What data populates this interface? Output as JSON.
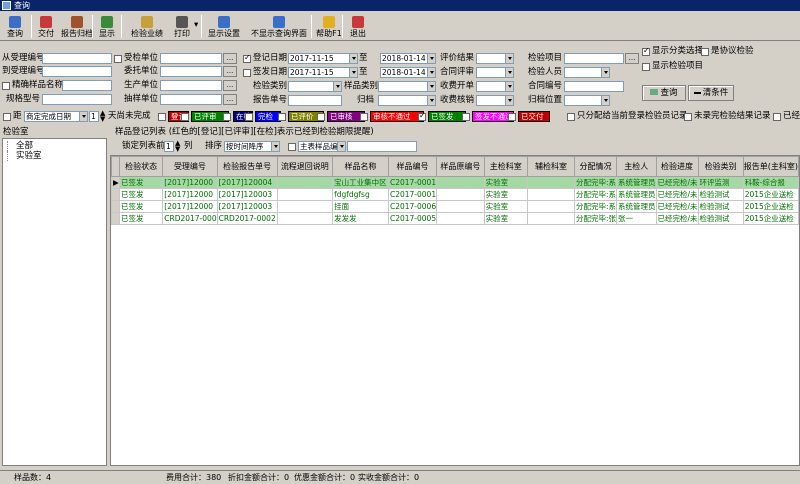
{
  "window": {
    "title": "查询"
  },
  "toolbar": [
    {
      "label": "查询",
      "icon": "search-icon"
    },
    {
      "label": "交付",
      "icon": "deliver-icon"
    },
    {
      "label": "报告归档",
      "icon": "archive-icon"
    },
    {
      "label": "显示",
      "icon": "display-icon"
    },
    {
      "label": "检验业绩",
      "icon": "performance-icon"
    },
    {
      "label": "打印",
      "icon": "print-icon"
    },
    {
      "label": "显示设置",
      "icon": "display-settings-icon"
    },
    {
      "label": "不显示查询界面",
      "icon": "hide-query-icon"
    },
    {
      "label": "帮助F1",
      "icon": "help-icon"
    },
    {
      "label": "退出",
      "icon": "exit-icon"
    }
  ],
  "form": {
    "acceptance_no_from": "从受理编号",
    "acceptance_no_to": "到受理编号",
    "exact_sample_name": "精确样品名称",
    "spec_model": "规格型号",
    "entrust_unit": "受检单位",
    "consign_unit": "委托单位",
    "produce_unit": "生产单位",
    "sampling_unit": "抽样单位",
    "reg_date": "登记日期",
    "issue_date": "签发日期",
    "test_category": "检验类别",
    "report_no": "报告单号",
    "date_from1": "2017-11-15",
    "date_to1": "2018-01-14",
    "date_from2": "2017-11-15",
    "date_to2": "2018-01-14",
    "to": "至",
    "eval_result": "评价结果",
    "contract_review": "合同评审",
    "fee_bill": "收费开单",
    "fee_verify": "收费核销",
    "sample_category": "样品类别",
    "archive": "归档",
    "test_item": "检验项目",
    "inspector": "检验人员",
    "contract_no": "合同编号",
    "archive_location": "归档位置",
    "show_category": "显示分类选择",
    "is_agreement": "是协议检验",
    "show_test_items": "显示检验项目",
    "query_btn": "查询",
    "clear_btn": "清条件"
  },
  "filter_row": {
    "distance": "距",
    "deadline": "商定完成日期",
    "days": "1",
    "days_unfinished": "天尚未完成",
    "only_assigned": "只分配给当前登录检验员记录",
    "not_finished_report": "未录完检验结果记录",
    "already": "已经"
  },
  "status_badges": [
    {
      "label": "登记",
      "bg": "#c00000",
      "fg": "#ffffff"
    },
    {
      "label": "已评审",
      "bg": "#008000",
      "fg": "#ffffff"
    },
    {
      "label": "在检",
      "bg": "#000080",
      "fg": "#ffffff"
    },
    {
      "label": "完检",
      "bg": "#0000ff",
      "fg": "#ffffff"
    },
    {
      "label": "已评价",
      "bg": "#808000",
      "fg": "#ffffff"
    },
    {
      "label": "已审核",
      "bg": "#800080",
      "fg": "#ffffff"
    },
    {
      "label": "审核不通过",
      "bg": "#ff0000",
      "fg": "#ffffff"
    },
    {
      "label": "已签发",
      "bg": "#008000",
      "fg": "#ffffff"
    },
    {
      "label": "签发不通过",
      "bg": "#ff00ff",
      "fg": "#ffffff"
    },
    {
      "label": "已交付",
      "bg": "#c00000",
      "fg": "#ffffff"
    }
  ],
  "left": {
    "title": "检验室",
    "tree": [
      "全部",
      "实验室"
    ]
  },
  "list": {
    "title": "样品登记列表 (红色的[登记][已评审][在检]表示已经到检验期限提醒)",
    "lock_label": "锁定列表前",
    "lock_value": "1",
    "lock_unit": "列",
    "sort_label": "排序",
    "sort_value": "按时间降序",
    "group_value": "主表样品编号"
  },
  "table": {
    "columns": [
      "检验状态",
      "受理编号",
      "检验报告单号",
      "流程退回说明",
      "样品名称",
      "样品编号",
      "样品原编号",
      "主检科室",
      "辅检科室",
      "分配情况",
      "主检人",
      "检验进度",
      "检验类别",
      "报告单(主科室)"
    ],
    "rows": [
      [
        "已签发",
        "[2017]12000",
        "[2017]120004",
        "",
        "宝山工业集中区",
        "C2017-0001",
        "",
        "实验室",
        "",
        "分配完毕:系",
        "系统管理员",
        "已经完检/未",
        "环评监测",
        "科鞍-综合报"
      ],
      [
        "已签发",
        "[2017]12000",
        "[2017]120003",
        "",
        "fdgfdgfsg",
        "C2017-0001",
        "",
        "实验室",
        "",
        "分配完毕:系",
        "系统管理员",
        "已经完检/未",
        "检验测试",
        "2015企业送检"
      ],
      [
        "已签发",
        "[2017]12000",
        "[2017]120003",
        "",
        "挂面",
        "C2017-0006",
        "",
        "实验室",
        "",
        "分配完毕:系",
        "系统管理员",
        "已经完检/未",
        "检验测试",
        "2015企业送检"
      ],
      [
        "已签发",
        "CRD2017-000",
        "CRD2017-0002",
        "",
        "发发发",
        "C2017-0005",
        "",
        "实验室",
        "",
        "分配完毕:张",
        "张一",
        "已经完检/未",
        "检验测试",
        "2015企业送检"
      ]
    ]
  },
  "statusbar": {
    "sample_count": "样品数：4",
    "fee_total": "费用合计：380",
    "discount_total": "折扣金额合计：0",
    "favor_total": "优惠金额合计：0",
    "actual_total": "实收金额合计：0"
  }
}
